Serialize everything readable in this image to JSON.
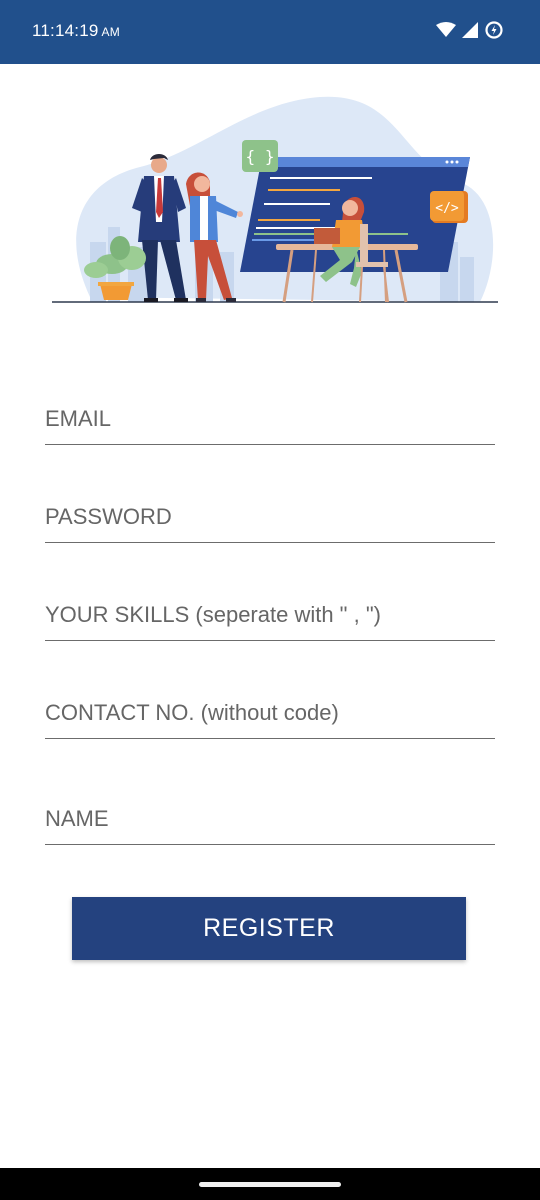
{
  "status_bar": {
    "time": "11:14:19",
    "ampm": "AM",
    "icons": [
      "wifi-icon",
      "cellular-signal-icon",
      "data-saver-icon"
    ],
    "background": "#21508c"
  },
  "hero": {
    "icons": [
      "braces-icon",
      "code-tag-icon"
    ],
    "braces_text": "{ }",
    "code_text": "</>"
  },
  "form": {
    "email_placeholder": "EMAIL",
    "password_placeholder": "PASSWORD",
    "skills_placeholder": "YOUR SKILLS (seperate with \" , \")",
    "contact_placeholder": "CONTACT NO. (without code)",
    "name_placeholder": "NAME"
  },
  "register_button": {
    "label": "REGISTER",
    "color": "#24427f"
  }
}
